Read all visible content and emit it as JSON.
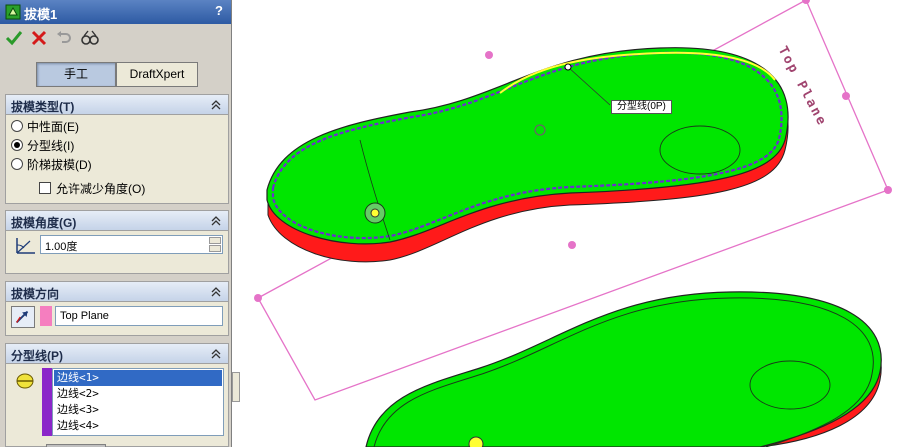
{
  "panel": {
    "title": "拔模1",
    "help": "?",
    "toolbar": {
      "ok_icon": "checkmark-icon",
      "cancel_icon": "x-icon",
      "undo_icon": "undo-icon",
      "detail_icon": "detailed-preview-icon"
    },
    "tabs": [
      {
        "label": "手工",
        "selected": true
      },
      {
        "label": "DraftXpert",
        "selected": false
      }
    ],
    "draft_type": {
      "title": "拔模类型(T)",
      "options": [
        {
          "label": "中性面(E)",
          "selected": false
        },
        {
          "label": "分型线(I)",
          "selected": true
        },
        {
          "label": "阶梯拔模(D)",
          "selected": false
        }
      ],
      "allow_reduce": {
        "label": "允许减少角度(O)",
        "checked": false
      }
    },
    "draft_angle": {
      "title": "拔模角度(G)",
      "value": "1.00度"
    },
    "direction": {
      "title": "拔模方向",
      "value": "Top Plane",
      "color": "#f57ebf"
    },
    "parting_lines": {
      "title": "分型线(P)",
      "color": "#8b26c9",
      "items": [
        "边线<1>",
        "边线<2>",
        "边线<3>",
        "边线<4>"
      ],
      "selected_index": 0
    }
  },
  "viewport": {
    "plane_label": "Top Plane",
    "callout": "分型线(0P)",
    "colors": {
      "plane": "#e573c8",
      "top_face": "#00e600",
      "side_face": "#ff1a1a",
      "parting_line": "#6a2fd0",
      "highlight": "#ffff33"
    }
  }
}
